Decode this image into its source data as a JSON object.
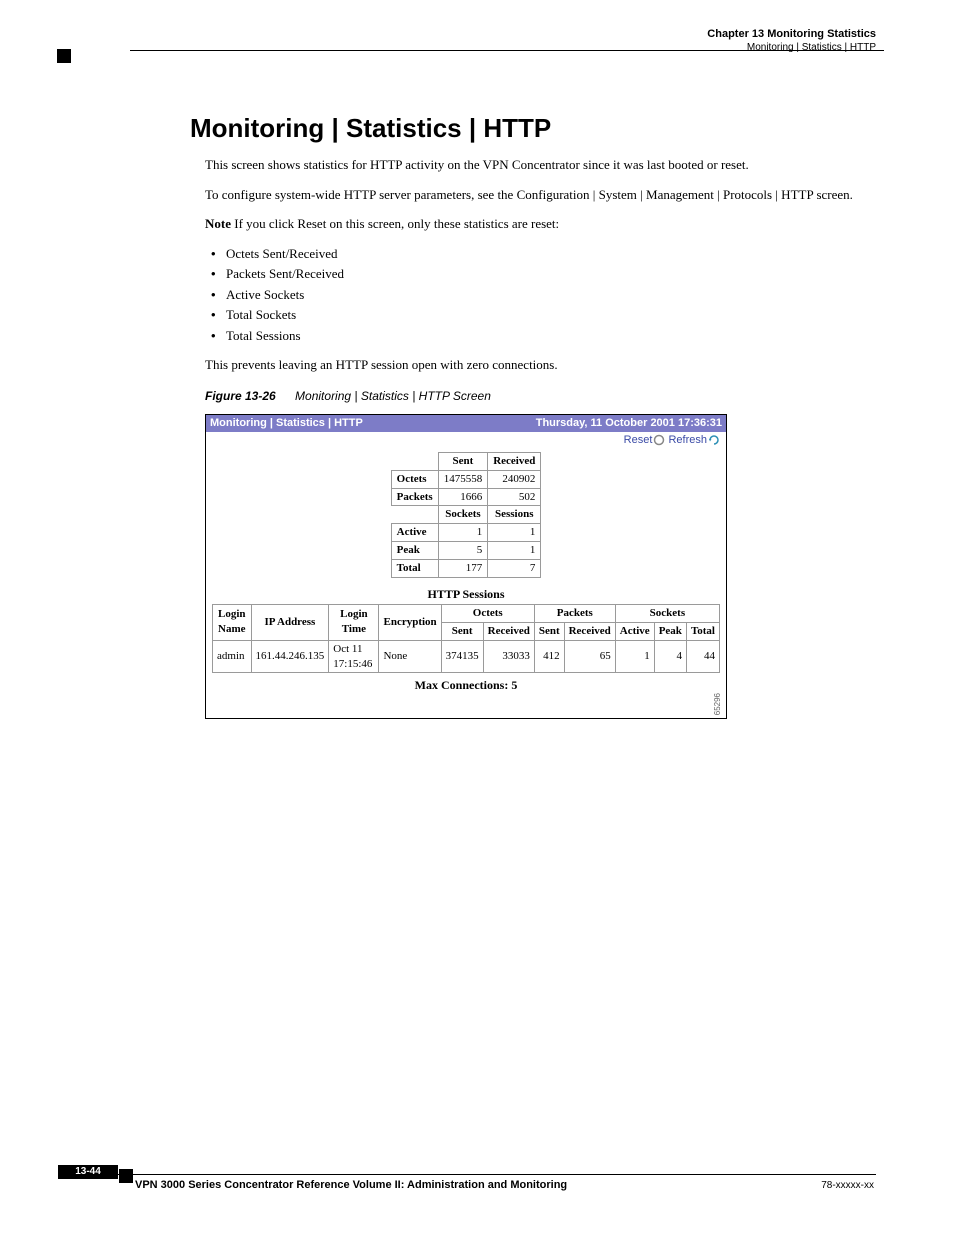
{
  "header": {
    "chapter": "Chapter 13      Monitoring Statistics",
    "section": "Monitoring | Statistics | HTTP"
  },
  "body": {
    "heading": "Monitoring | Statistics | HTTP",
    "p1": "This screen shows statistics for HTTP activity on the VPN Concentrator since it was last booted or reset.",
    "p2": "To configure system-wide HTTP server parameters, see the Configuration | System | Management | Protocols | HTTP screen.",
    "note_label": "Note",
    "note_text": "If you click Reset on this screen, only these statistics are reset:",
    "bullets": [
      "Octets Sent/Received",
      "Packets Sent/Received",
      "Active Sockets",
      "Total Sockets",
      "Total Sessions"
    ],
    "p3": "This prevents leaving an HTTP session open with zero connections."
  },
  "figure": {
    "num": "Figure 13-26",
    "title": "Monitoring | Statistics | HTTP Screen"
  },
  "screenshot": {
    "breadcrumb": "Monitoring | Statistics | HTTP",
    "timestamp": "Thursday, 11 October 2001 17:36:31",
    "reset": "Reset",
    "refresh": "Refresh",
    "summary": {
      "col1": "Sent",
      "col2": "Received",
      "octets_label": "Octets",
      "octets_sent": "1475558",
      "octets_recv": "240902",
      "packets_label": "Packets",
      "packets_sent": "1666",
      "packets_recv": "502",
      "col3": "Sockets",
      "col4": "Sessions",
      "active_label": "Active",
      "active_sock": "1",
      "active_sess": "1",
      "peak_label": "Peak",
      "peak_sock": "5",
      "peak_sess": "1",
      "total_label": "Total",
      "total_sock": "177",
      "total_sess": "7"
    },
    "sessions": {
      "title": "HTTP Sessions",
      "group_octets": "Octets",
      "group_packets": "Packets",
      "group_sockets": "Sockets",
      "cols": {
        "login": "Login Name",
        "ip": "IP Address",
        "time": "Login Time",
        "enc": "Encryption",
        "osent": "Sent",
        "orecv": "Received",
        "psent": "Sent",
        "precv": "Received",
        "sactive": "Active",
        "speak": "Peak",
        "stotal": "Total"
      },
      "row": {
        "login": "admin",
        "ip": "161.44.246.135",
        "time": "Oct 11 17:15:46",
        "enc": "None",
        "osent": "374135",
        "orecv": "33033",
        "psent": "412",
        "precv": "65",
        "sactive": "1",
        "speak": "4",
        "stotal": "44"
      },
      "maxconn": "Max Connections: 5"
    },
    "srcnum": "65296"
  },
  "footer": {
    "pagenum": "13-44",
    "booktitle": "VPN 3000 Series Concentrator Reference Volume II: Administration and Monitoring",
    "docnum": "78-xxxxx-xx"
  }
}
